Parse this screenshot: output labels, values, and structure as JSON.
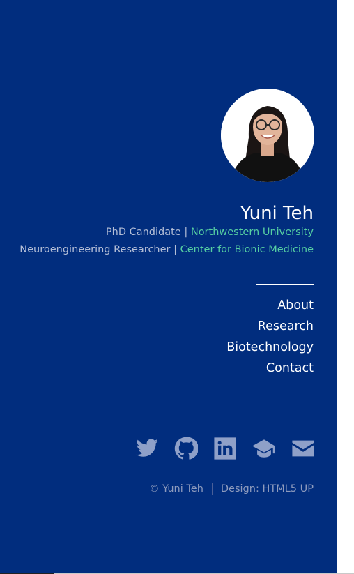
{
  "profile": {
    "name": "Yuni Teh",
    "line1_prefix": "PhD Candidate",
    "line1_sep": "|",
    "line1_link": "Northwestern University",
    "line2_prefix": "Neuroengineering Researcher",
    "line2_sep": "|",
    "line2_link": "Center for Bionic Medicine"
  },
  "nav": {
    "items": [
      "About",
      "Research",
      "Biotechnology",
      "Contact"
    ]
  },
  "social": {
    "icons": [
      "twitter-icon",
      "github-icon",
      "linkedin-icon",
      "graduation-cap-icon",
      "envelope-icon"
    ]
  },
  "footer": {
    "copyright": "© Yuni Teh",
    "design": "Design: HTML5 UP"
  },
  "colors": {
    "sidebar_bg": "#012d7e",
    "accent_link": "#56cfa2",
    "muted_text": "#b4bed6",
    "icon": "#8fa0c8"
  }
}
